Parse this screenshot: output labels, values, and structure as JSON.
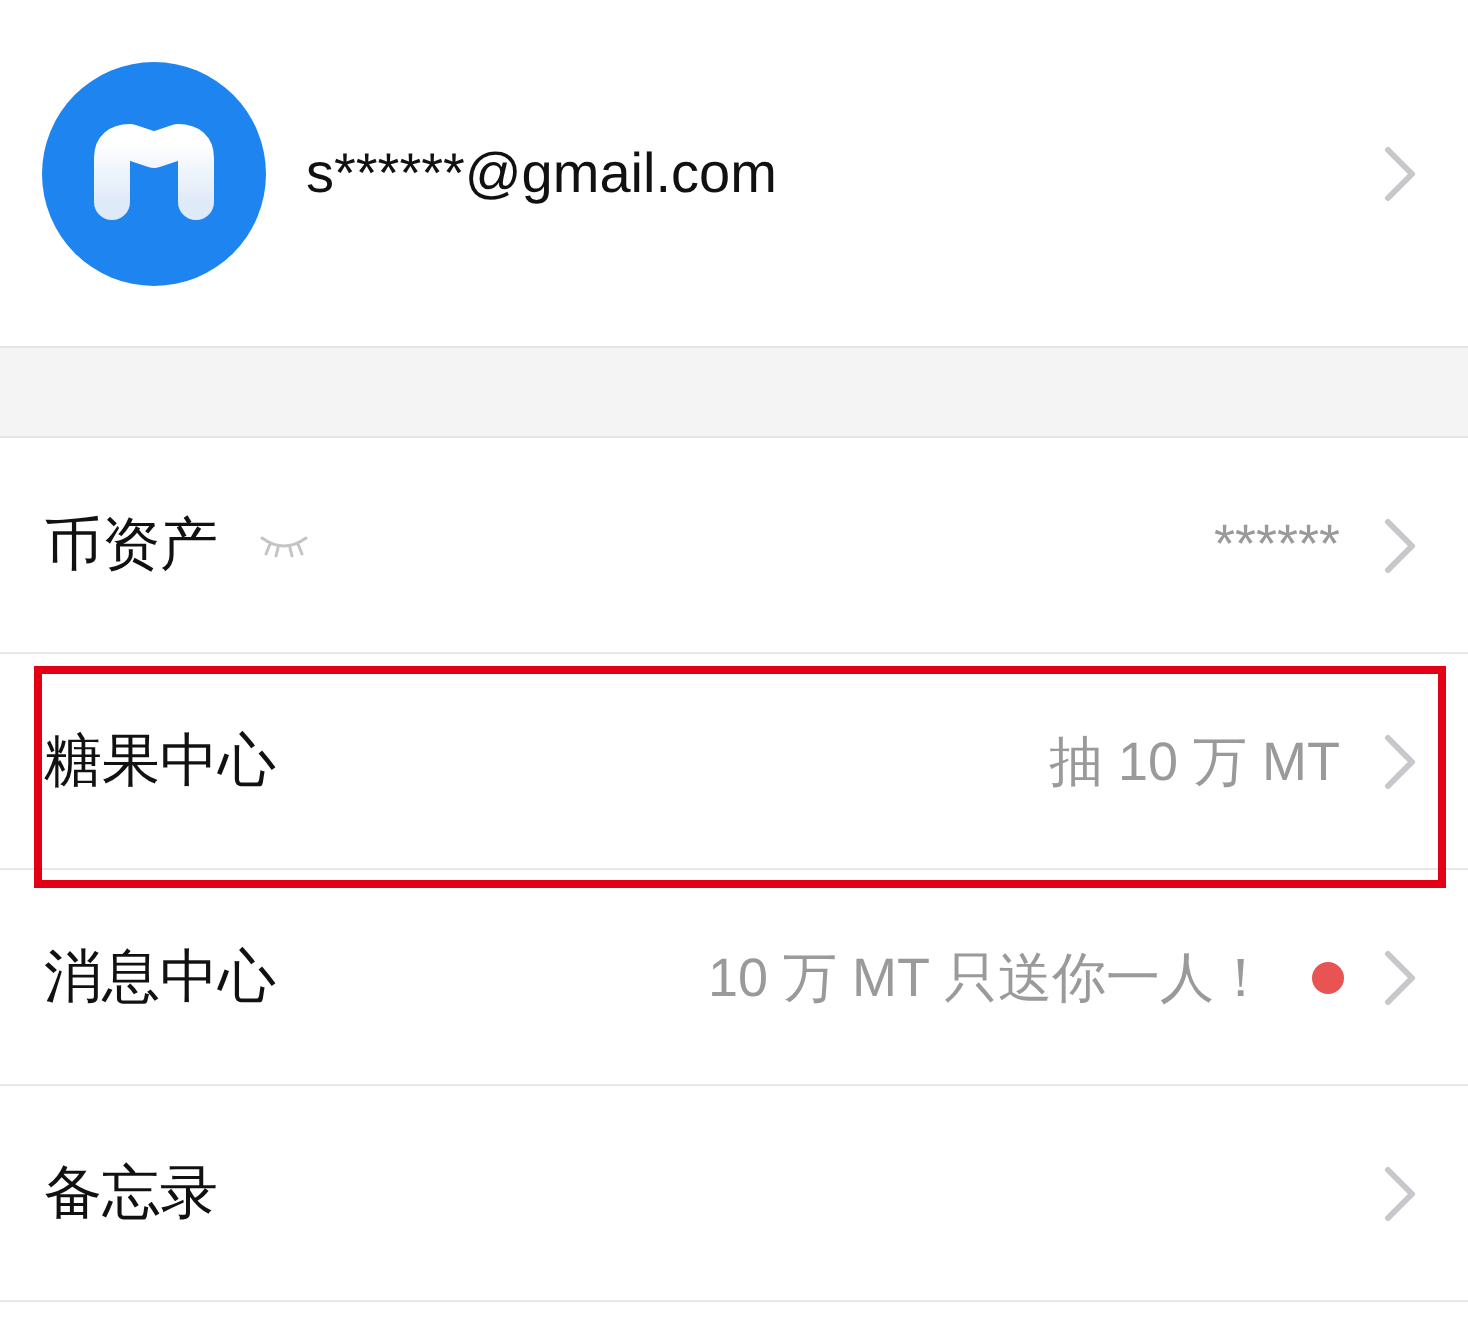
{
  "account": {
    "email": "s******@gmail.com"
  },
  "menu": [
    {
      "label": "币资产",
      "value": "******",
      "hidden": true,
      "unread": false,
      "highlighted": false
    },
    {
      "label": "糖果中心",
      "value": "抽 10 万 MT",
      "hidden": false,
      "unread": false,
      "highlighted": true
    },
    {
      "label": "消息中心",
      "value": "10 万 MT 只送你一人！",
      "hidden": false,
      "unread": true,
      "highlighted": false
    },
    {
      "label": "备忘录",
      "hidden": false,
      "unread": false,
      "highlighted": false
    }
  ]
}
